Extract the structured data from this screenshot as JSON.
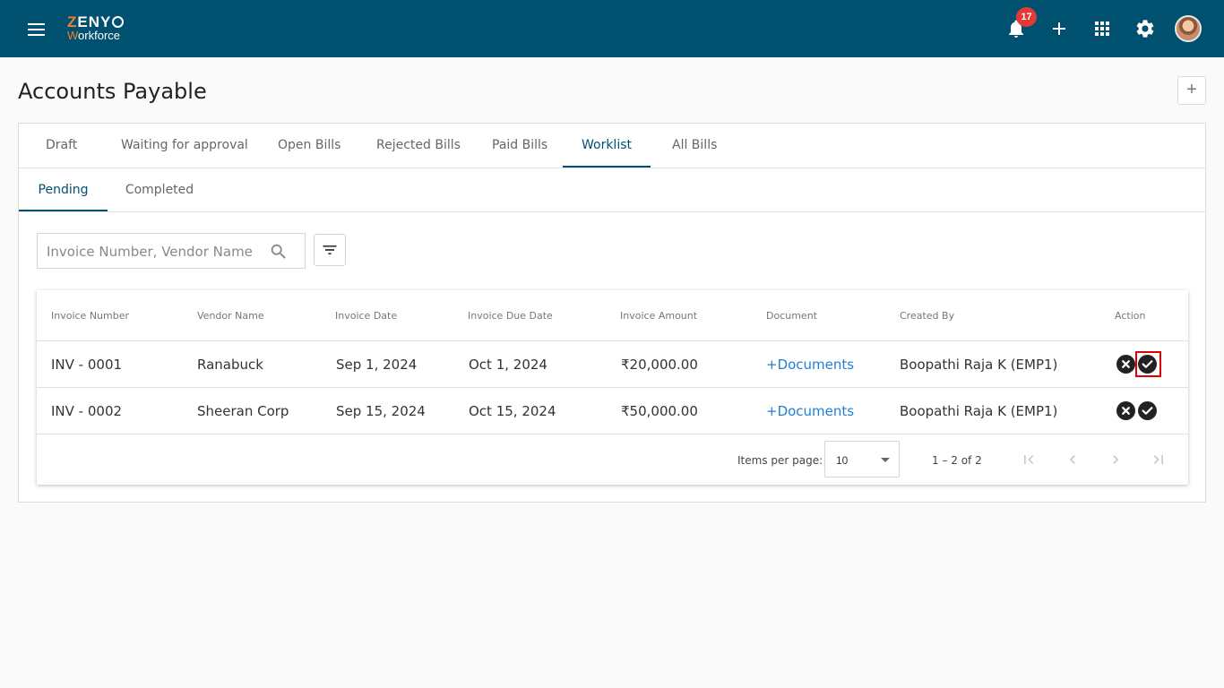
{
  "header": {
    "logo_top": "ZENY",
    "logo_bottom": "Workforce",
    "notification_count": "17",
    "icons": [
      "menu-icon",
      "bell-icon",
      "plus-icon",
      "apps-grid-icon",
      "gear-icon"
    ]
  },
  "page": {
    "title": "Accounts Payable",
    "add_label": "+"
  },
  "tabs": [
    {
      "label": "Draft"
    },
    {
      "label": "Waiting for approval"
    },
    {
      "label": "Open Bills"
    },
    {
      "label": "Rejected Bills"
    },
    {
      "label": "Paid Bills"
    },
    {
      "label": "Worklist"
    },
    {
      "label": "All Bills"
    }
  ],
  "active_tab": "Worklist",
  "subtabs": [
    {
      "label": "Pending"
    },
    {
      "label": "Completed"
    }
  ],
  "active_subtab": "Pending",
  "search": {
    "placeholder": "Invoice Number, Vendor Name",
    "value": ""
  },
  "table": {
    "columns": [
      "Invoice Number",
      "Vendor Name",
      "Invoice Date",
      "Invoice Due Date",
      "Invoice Amount",
      "Document",
      "Created By",
      "Action"
    ],
    "rows": [
      {
        "invoice_number": "INV - 0001",
        "vendor_name": "Ranabuck",
        "invoice_date": "Sep 1, 2024",
        "due_date": "Oct 1, 2024",
        "amount": "₹20,000.00",
        "document": "+Documents",
        "created_by": "Boopathi Raja K (EMP1)"
      },
      {
        "invoice_number": "INV - 0002",
        "vendor_name": "Sheeran Corp",
        "invoice_date": "Sep 15, 2024",
        "due_date": "Oct 15, 2024",
        "amount": "₹50,000.00",
        "document": "+Documents",
        "created_by": "Boopathi Raja K (EMP1)"
      }
    ]
  },
  "paginator": {
    "items_per_page_label": "Items per page:",
    "items_per_page": "10",
    "range": "1 – 2 of 2"
  },
  "colors": {
    "header_bg": "#00506f",
    "accent": "#00506f",
    "logo_orange": "#f0812c",
    "link": "#1e7fd6",
    "badge": "#e53935",
    "highlight": "#e00000"
  }
}
